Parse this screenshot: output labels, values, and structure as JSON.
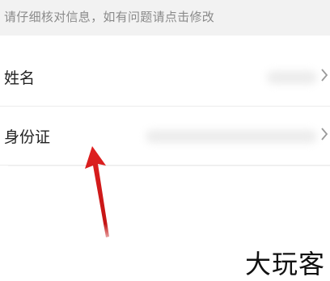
{
  "notice": {
    "text": "请仔细核对信息，如有问题请点击修改"
  },
  "rows": [
    {
      "label": "姓名"
    },
    {
      "label": "身份证"
    }
  ],
  "annotation": {
    "arrow_color": "#e02020"
  },
  "watermark": {
    "text": "大玩客"
  },
  "icons": {
    "row_chevron": "chevron-right-icon"
  }
}
